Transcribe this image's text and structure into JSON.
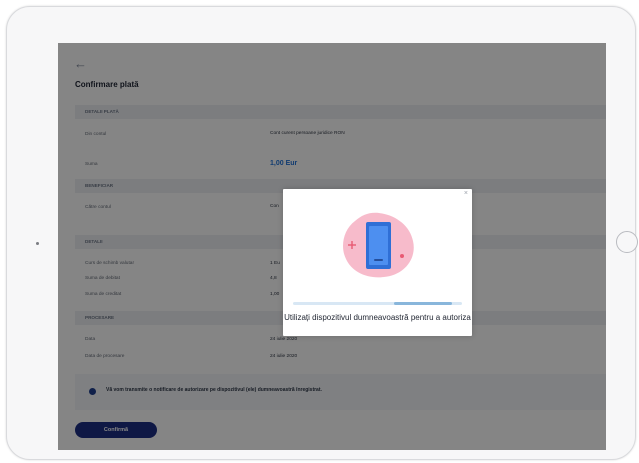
{
  "page": {
    "back_icon": "back-arrow-icon",
    "title": "Confirmare plată",
    "sections": {
      "payment_details": "DETALII PLATĂ",
      "beneficiary": "BENEFICIAR",
      "details": "DETALII",
      "processing": "PROCESARE"
    },
    "rows": {
      "from_account_label": "Din contul",
      "from_account_value": "Cont curent persoane juridice RON",
      "from_account_sub1": "",
      "from_account_sub2": "",
      "amount_label": "Suma",
      "amount_value": "1,00 Eur",
      "beneficiary_label": "Către contul",
      "beneficiary_value": "Con",
      "fx_rate_label": "Curs de schimb valutar",
      "fx_rate_value": "1 Eu",
      "debit_amount_label": "Suma de debitat",
      "debit_amount_value": "4,8",
      "credit_amount_label": "Suma de creditat",
      "credit_amount_value": "1,00",
      "date_label": "Data",
      "date_value": "24 iulie 2020",
      "processing_date_label": "Data de procesare",
      "processing_date_value": "24 iulie 2020"
    },
    "consent_text": "Vă vom transmite o notificare de autorizare pe dispozitivul (ele) dumneavoastră înregistrat.",
    "confirm_label": "Confirmă"
  },
  "modal": {
    "close_icon": "close-icon",
    "illustration_icon": "mobile-device-icon",
    "message": "Utilizați dispozitivul dumneavoastră pentru a autoriza",
    "progress_fraction": 0.34
  },
  "colors": {
    "accent": "#1d2f84",
    "amount_blue": "#2374d8",
    "overlay": "#000000",
    "blob_pink": "#f28aa6"
  }
}
